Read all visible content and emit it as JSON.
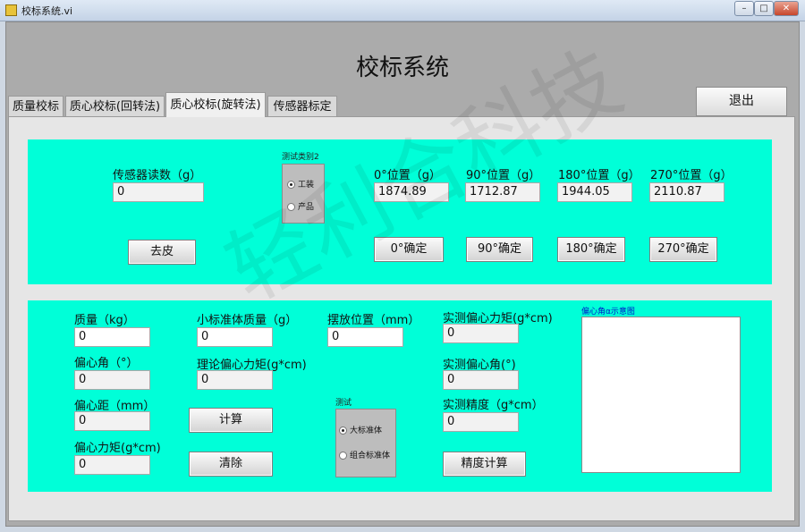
{
  "window": {
    "title": "校标系统.vi",
    "minimize": "–",
    "maximize": "□",
    "close": "✕"
  },
  "app": {
    "title": "校标系统",
    "exit_label": "退出",
    "watermark": "轻利合科技"
  },
  "tabs": [
    {
      "label": "质量校标"
    },
    {
      "label": "质心校标(回转法)"
    },
    {
      "label": "质心校标(旋转法)",
      "active": true
    },
    {
      "label": "传感器标定"
    }
  ],
  "top_section": {
    "sensor_reading": {
      "label": "传感器读数（g）",
      "value": "0"
    },
    "tare_label": "去皮",
    "test_type": {
      "title": "测试类别2",
      "options": [
        {
          "label": "工装",
          "selected": true
        },
        {
          "label": "产品",
          "selected": false
        }
      ]
    },
    "positions": [
      {
        "label": "0°位置（g）",
        "value": "1874.89",
        "button": "0°确定"
      },
      {
        "label": "90°位置（g）",
        "value": "1712.87",
        "button": "90°确定"
      },
      {
        "label": "180°位置（g）",
        "value": "1944.05",
        "button": "180°确定"
      },
      {
        "label": "270°位置（g）",
        "value": "2110.87",
        "button": "270°确定"
      }
    ]
  },
  "bottom_section": {
    "mass": {
      "label": "质量（kg）",
      "value": "0"
    },
    "eccentric_angle": {
      "label": "偏心角（°）",
      "value": "0"
    },
    "eccentric_distance": {
      "label": "偏心距（mm）",
      "value": "0"
    },
    "eccentric_moment": {
      "label": "偏心力矩(g*cm)",
      "value": "0"
    },
    "small_std_mass": {
      "label": "小标准体质量（g）",
      "value": "0"
    },
    "theory_moment": {
      "label": "理论偏心力矩(g*cm)",
      "value": "0"
    },
    "calculate_label": "计算",
    "clear_label": "清除",
    "place_position": {
      "label": "摆放位置（mm）",
      "value": "0"
    },
    "test": {
      "title": "测试",
      "options": [
        {
          "label": "大标准体",
          "selected": true
        },
        {
          "label": "组合标准体",
          "selected": false
        }
      ]
    },
    "measured_moment": {
      "label": "实测偏心力矩(g*cm)",
      "value": "0"
    },
    "measured_angle": {
      "label": "实测偏心角(°)",
      "value": "0"
    },
    "measured_accuracy": {
      "label": "实测精度（g*cm）",
      "value": "0"
    },
    "accuracy_calc_label": "精度计算",
    "diagram_title": "偏心角α示意图"
  }
}
